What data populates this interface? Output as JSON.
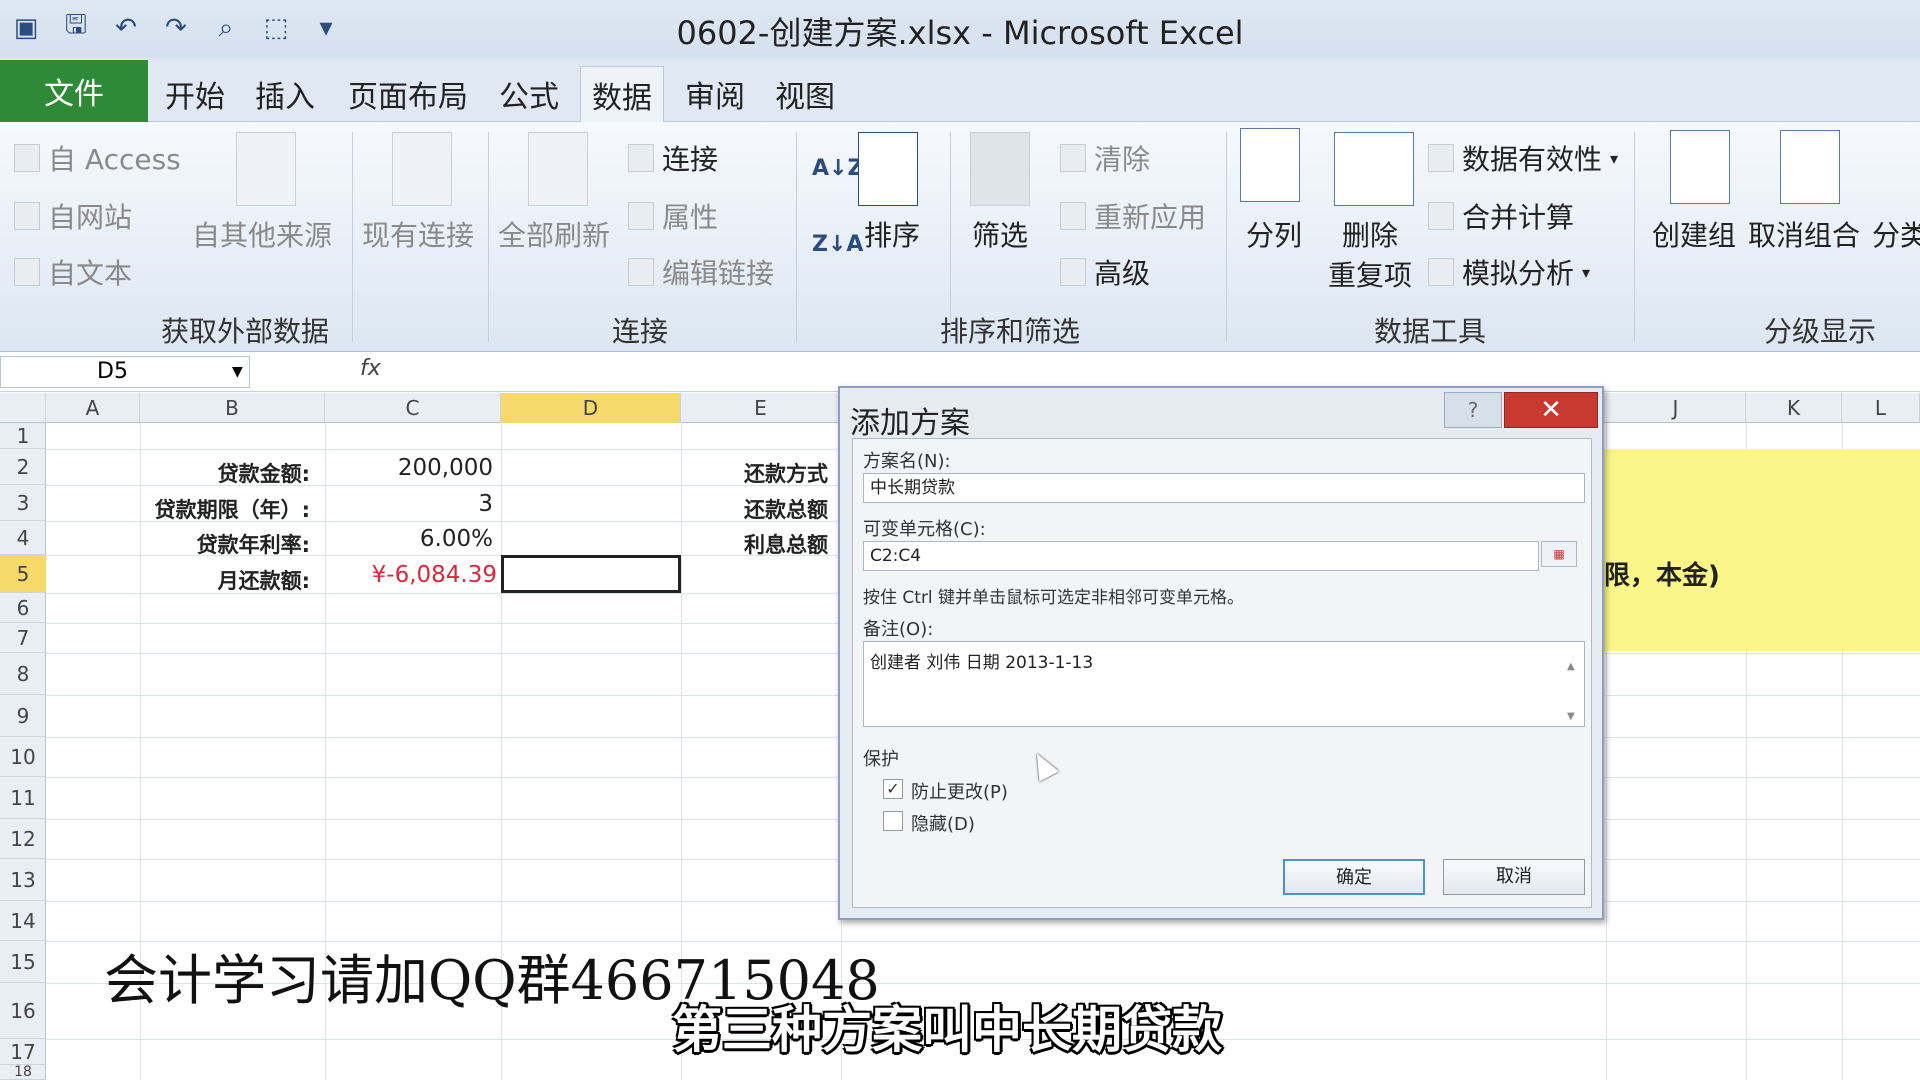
{
  "window": {
    "title": "0602-创建方案.xlsx - Microsoft Excel"
  },
  "qat": {
    "save_icon": "save-icon",
    "undo_icon": "undo-icon",
    "redo_icon": "redo-icon",
    "preview_icon": "print-preview-icon",
    "customize_icon": "chevron-down-icon"
  },
  "tabs": {
    "file": "文件",
    "home": "开始",
    "insert": "插入",
    "page_layout": "页面布局",
    "formulas": "公式",
    "data": "数据",
    "review": "审阅",
    "view": "视图"
  },
  "ribbon": {
    "external": {
      "access": "自 Access",
      "web": "自网站",
      "text": "自文本",
      "other": "自其他来源",
      "existing": "现有连接",
      "label": "获取外部数据"
    },
    "connections": {
      "refresh_all": "全部刷新",
      "connect": "连接",
      "properties": "属性",
      "edit_links": "编辑链接",
      "label": "连接"
    },
    "sort_filter": {
      "sort": "排序",
      "filter": "筛选",
      "clear": "清除",
      "reapply": "重新应用",
      "advanced": "高级",
      "label": "排序和筛选"
    },
    "data_tools": {
      "text_to_columns": "分列",
      "remove_dup_1": "删除",
      "remove_dup_2": "重复项",
      "validation": "数据有效性",
      "consolidate": "合并计算",
      "what_if": "模拟分析",
      "label": "数据工具"
    },
    "outline": {
      "group": "创建组",
      "ungroup": "取消组合",
      "subtotal": "分类",
      "label": "分级显示"
    }
  },
  "formula_bar": {
    "name_box": "D5",
    "fx": "fx"
  },
  "columns": [
    "A",
    "B",
    "C",
    "D",
    "E",
    "J",
    "K",
    "L"
  ],
  "rows": [
    "1",
    "2",
    "3",
    "4",
    "5",
    "6",
    "7",
    "8",
    "9",
    "10",
    "11",
    "12",
    "13",
    "14",
    "15",
    "16",
    "17",
    "18"
  ],
  "sheet": {
    "b2": "贷款金额:",
    "c2": "200,000",
    "b3": "贷款期限（年）:",
    "c3": "3",
    "b4": "贷款年利率:",
    "c4": "6.00%",
    "b5": "月还款额:",
    "c5": "¥-6,084.39",
    "e2": "还款方式",
    "e3": "还款总额",
    "e4": "利息总额",
    "j5": "限，本金)"
  },
  "colors": {
    "negative": "#e0263b",
    "selection": "#f5d96b",
    "highlight_fill": "#fbf58a"
  },
  "dialog": {
    "title": "添加方案",
    "help": "?",
    "close": "✕",
    "name_label": "方案名(N):",
    "name_value": "中长期贷款",
    "changing_label": "可变单元格(C):",
    "changing_value": "C2:C4",
    "hint": "按住 Ctrl 键并单击鼠标可选定非相邻可变单元格。",
    "comment_label": "备注(O):",
    "comment_value": "创建者 刘伟 日期 2013-1-13",
    "protection_label": "保护",
    "prevent_changes": "防止更改(P)",
    "prevent_checked": true,
    "hide": "隐藏(D)",
    "hide_checked": false,
    "ok": "确定",
    "cancel": "取消"
  },
  "overlay": {
    "watermark": "会计学习请加QQ群466715048",
    "subtitle": "第三种方案叫中长期贷款"
  }
}
